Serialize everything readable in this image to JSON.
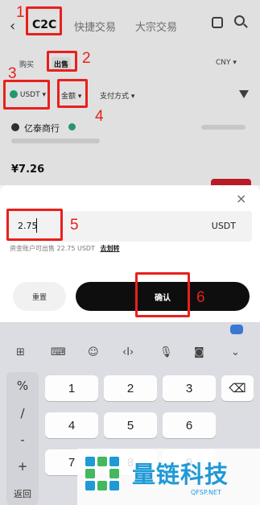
{
  "header": {
    "tabs": [
      "C2C",
      "快捷交易",
      "大宗交易"
    ],
    "active_tab": "C2C"
  },
  "trade_types": [
    "购买",
    "出售"
  ],
  "currency": "CNY",
  "filters": {
    "coin": "USDT",
    "amount": "金额",
    "payment": "支付方式"
  },
  "listing": {
    "merchant": "亿泰商行",
    "price": "¥7.26"
  },
  "modal": {
    "input_value": "2.75",
    "input_unit": "USDT",
    "available_text": "资金账户可出售 22.75 USDT",
    "transfer_link": "去划转",
    "reset_label": "重置",
    "confirm_label": "确认"
  },
  "keyboard": {
    "symbols": [
      "%",
      "/",
      "-",
      "+"
    ],
    "rows": [
      [
        "1",
        "2",
        "3"
      ],
      [
        "4",
        "5",
        "6"
      ],
      [
        "7",
        "8",
        "9"
      ]
    ],
    "bottom_left": "返回"
  },
  "annotations": [
    "1",
    "2",
    "3",
    "4",
    "5",
    "6"
  ],
  "watermark": {
    "title": "量链科技",
    "site": "QFSP.NET"
  },
  "colors": {
    "annotation": "#e8201c",
    "watermark": "#1f9ad6"
  }
}
